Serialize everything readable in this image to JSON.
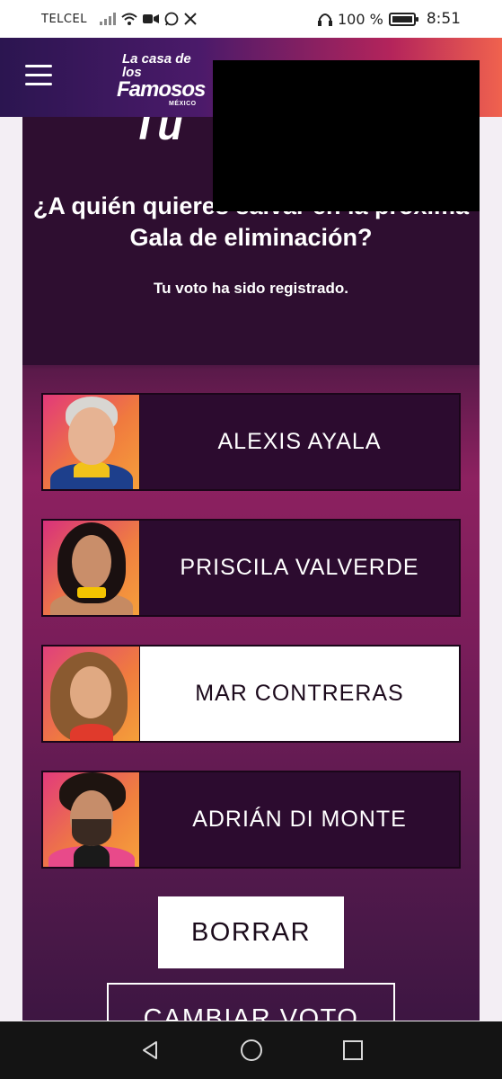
{
  "status_bar": {
    "carrier": "TELCEL",
    "battery_percent": "100 %",
    "time": "8:51",
    "icons": [
      "signal-icon",
      "wifi-icon",
      "video-icon",
      "whatsapp-icon",
      "x-icon",
      "headphones-icon",
      "battery-icon"
    ]
  },
  "header": {
    "menu_icon": "hamburger-icon",
    "logo": {
      "line1": "La casa de los",
      "line2": "Famosos",
      "line3": "MÉXICO"
    }
  },
  "poll": {
    "partial_title": "Tu",
    "question": "¿A quién quieres salvar en la próxima Gala de eliminación?",
    "status_message": "Tu voto ha sido registrado."
  },
  "candidates": [
    {
      "name": "ALEXIS AYALA",
      "selected": false
    },
    {
      "name": "PRISCILA VALVERDE",
      "selected": false
    },
    {
      "name": "MAR CONTRERAS",
      "selected": true
    },
    {
      "name": "ADRIÁN DI MONTE",
      "selected": false
    }
  ],
  "actions": {
    "clear_label": "BORRAR",
    "change_vote_label": "CAMBIAR VOTO"
  },
  "nav_bar": {
    "icons": [
      "back-icon",
      "home-icon",
      "recents-icon"
    ]
  },
  "colors": {
    "header_gradient_start": "#2b1550",
    "header_gradient_end": "#f0624e",
    "panel_dark": "#2e0e30",
    "content_magenta": "#8d2160",
    "selected_bg": "#ffffff"
  }
}
